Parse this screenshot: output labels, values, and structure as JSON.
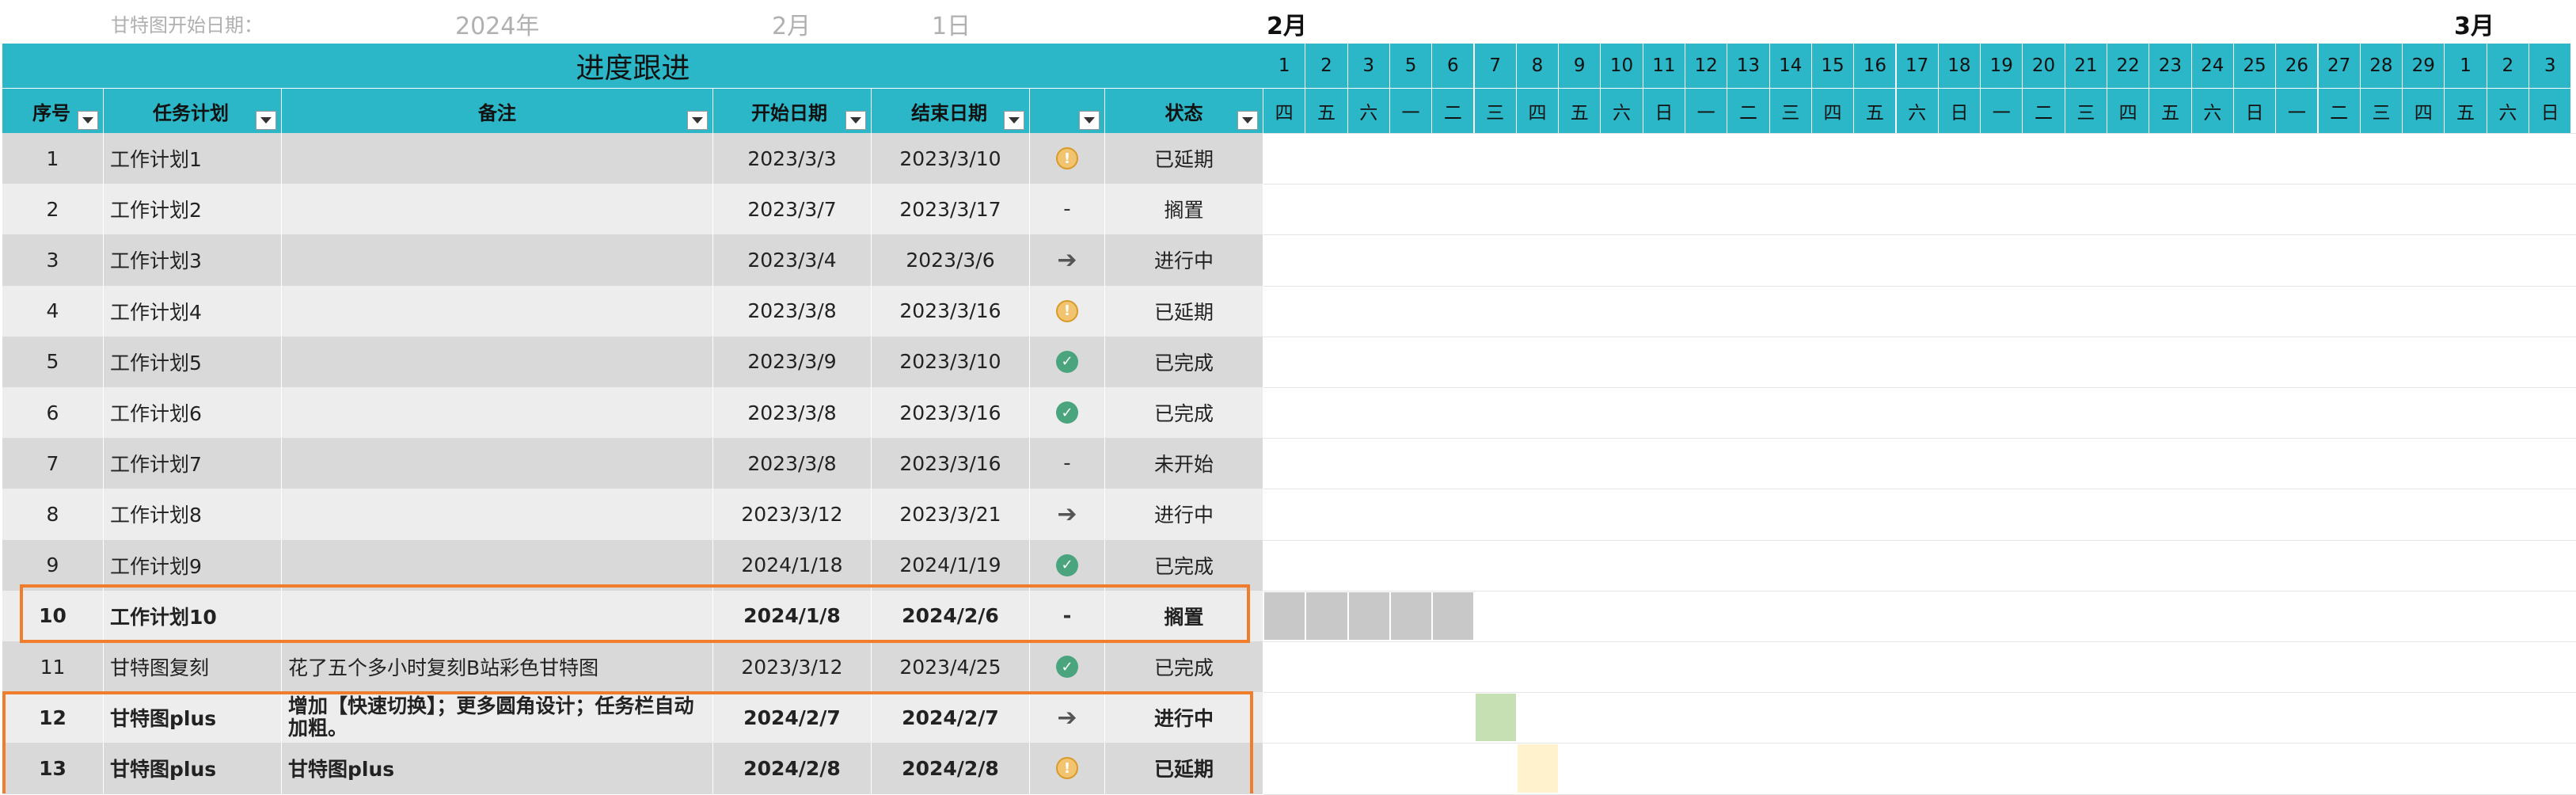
{
  "top": {
    "start_label": "甘特图开始日期：",
    "year": "2024年",
    "month": "2月",
    "day": "1日",
    "month_feb": "2月",
    "month_mar": "3月"
  },
  "title": "进度跟进",
  "headers": {
    "seq": "序号",
    "task": "任务计划",
    "note": "备注",
    "start": "开始日期",
    "end": "结束日期",
    "status_icon": "",
    "status": "状态"
  },
  "days": [
    "1",
    "2",
    "3",
    "5",
    "6",
    "7",
    "8",
    "9",
    "10",
    "11",
    "12",
    "13",
    "14",
    "15",
    "16",
    "17",
    "18",
    "19",
    "20",
    "21",
    "22",
    "23",
    "24",
    "25",
    "26",
    "27",
    "28",
    "29",
    "1",
    "2",
    "3"
  ],
  "weekdays": [
    "四",
    "五",
    "六",
    "一",
    "二",
    "三",
    "四",
    "五",
    "六",
    "日",
    "一",
    "二",
    "三",
    "四",
    "五",
    "六",
    "日",
    "一",
    "二",
    "三",
    "四",
    "五",
    "六",
    "日",
    "一",
    "二",
    "三",
    "四",
    "五",
    "六",
    "日"
  ],
  "rows": [
    {
      "seq": "1",
      "task": "工作计划1",
      "note": "",
      "start": "2023/3/3",
      "end": "2023/3/10",
      "icon": "warning-icon",
      "status": "已延期"
    },
    {
      "seq": "2",
      "task": "工作计划2",
      "note": "",
      "start": "2023/3/7",
      "end": "2023/3/17",
      "icon": "dash",
      "status": "搁置"
    },
    {
      "seq": "3",
      "task": "工作计划3",
      "note": "",
      "start": "2023/3/4",
      "end": "2023/3/6",
      "icon": "arrow-right-icon",
      "status": "进行中"
    },
    {
      "seq": "4",
      "task": "工作计划4",
      "note": "",
      "start": "2023/3/8",
      "end": "2023/3/16",
      "icon": "warning-icon",
      "status": "已延期"
    },
    {
      "seq": "5",
      "task": "工作计划5",
      "note": "",
      "start": "2023/3/9",
      "end": "2023/3/10",
      "icon": "check-icon",
      "status": "已完成"
    },
    {
      "seq": "6",
      "task": "工作计划6",
      "note": "",
      "start": "2023/3/8",
      "end": "2023/3/16",
      "icon": "check-icon",
      "status": "已完成"
    },
    {
      "seq": "7",
      "task": "工作计划7",
      "note": "",
      "start": "2023/3/8",
      "end": "2023/3/16",
      "icon": "dash",
      "status": "未开始"
    },
    {
      "seq": "8",
      "task": "工作计划8",
      "note": "",
      "start": "2023/3/12",
      "end": "2023/3/21",
      "icon": "arrow-right-icon",
      "status": "进行中"
    },
    {
      "seq": "9",
      "task": "工作计划9",
      "note": "",
      "start": "2024/1/18",
      "end": "2024/1/19",
      "icon": "check-icon",
      "status": "已完成"
    },
    {
      "seq": "10",
      "task": "工作计划10",
      "note": "",
      "start": "2024/1/8",
      "end": "2024/2/6",
      "icon": "dash",
      "status": "搁置",
      "bold": true
    },
    {
      "seq": "11",
      "task": "甘特图复刻",
      "note": "花了五个多小时复刻B站彩色甘特图",
      "start": "2023/3/12",
      "end": "2023/4/25",
      "icon": "check-icon",
      "status": "已完成"
    },
    {
      "seq": "12",
      "task": "甘特图plus",
      "note": "增加【快速切换】；更多圆角设计；任务栏自动加粗。",
      "start": "2024/2/7",
      "end": "2024/2/7",
      "icon": "arrow-right-icon",
      "status": "进行中",
      "bold": true
    },
    {
      "seq": "13",
      "task": "甘特图plus",
      "note": "甘特图plus",
      "start": "2024/2/8",
      "end": "2024/2/8",
      "icon": "warning-icon",
      "status": "已延期",
      "bold": true
    }
  ],
  "gantt": {
    "row10_days": [
      1,
      2,
      3,
      4,
      5
    ],
    "row12_day": 6,
    "row13_day": 7,
    "colors": {
      "gray": "#c8c8c8",
      "green": "#c6e0b4",
      "yellow": "#fff2cc"
    }
  }
}
